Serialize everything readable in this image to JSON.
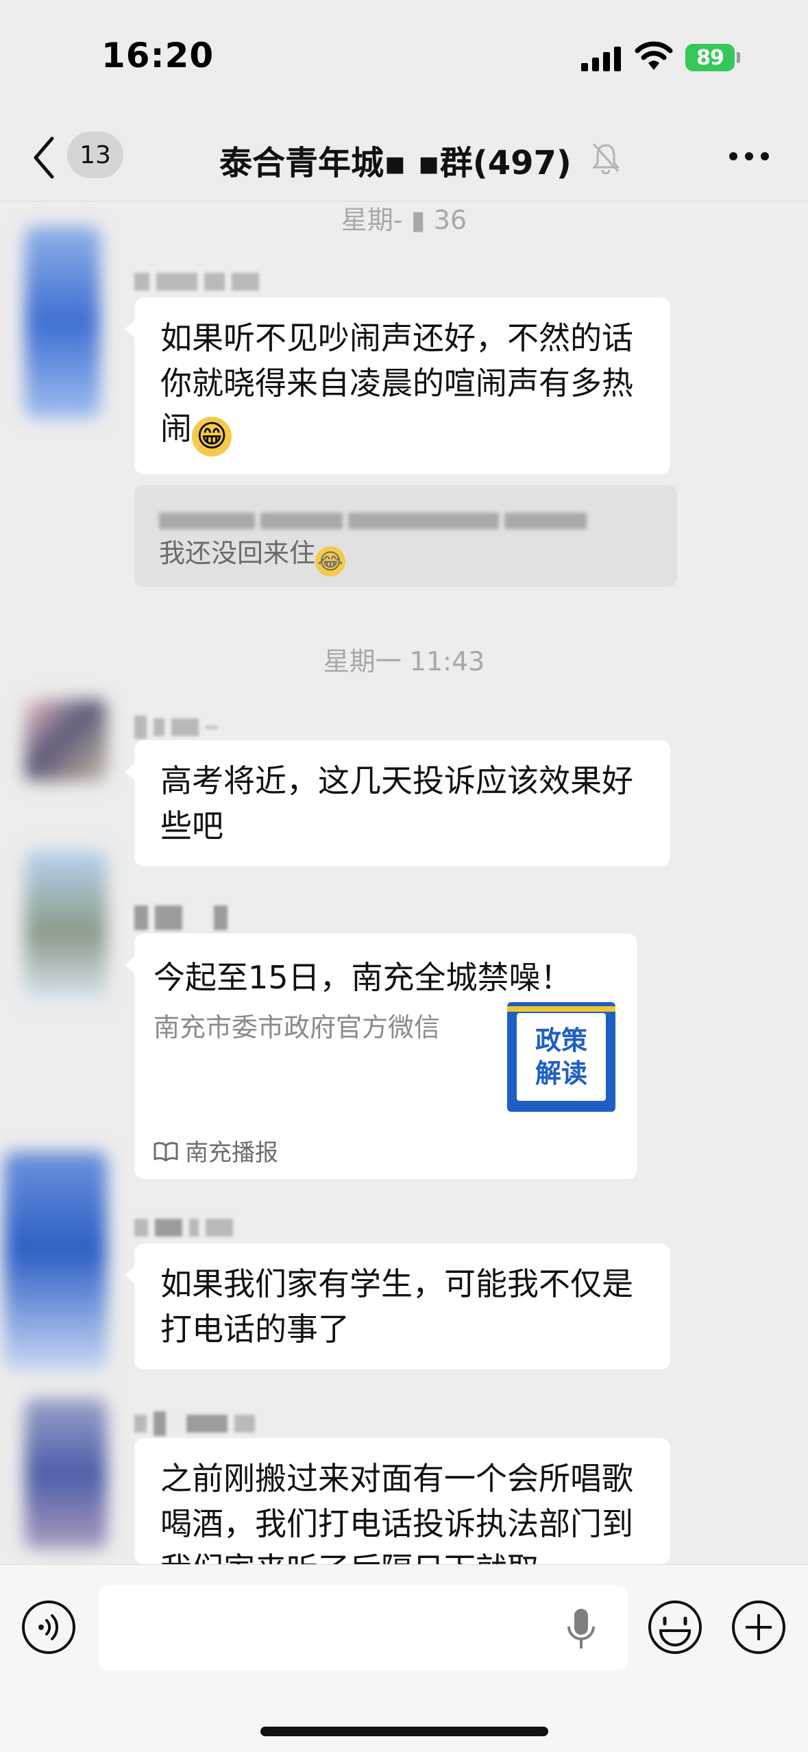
{
  "status_bar": {
    "time": "16:20",
    "battery": "89"
  },
  "nav": {
    "unread_count": "13",
    "title": "泰合青年城▪ ▪群(497)"
  },
  "chat": {
    "time_separators": [
      "星期- ▮ 36",
      "星期一 11:43"
    ],
    "messages": [
      {
        "text": "如果听不见吵闹声还好，不然的话你就晓得来自凌晨的喧闹声有多热闹",
        "emoji": "😁"
      },
      {
        "quote_visible_text": "我还没回来住",
        "emoji": "😂"
      },
      {
        "text": "高考将近，这几天投诉应该效果好些吧"
      },
      {
        "card_title": "今起至15日，南充全城禁噪！",
        "card_desc": "南充市委市政府官方微信",
        "card_thumb_line1": "政策",
        "card_thumb_line2": "解读",
        "card_source": "南充播报"
      },
      {
        "text": "如果我们家有学生，可能我不仅是打电话的事了"
      },
      {
        "text": "之前刚搬过来对面有一个会所唱歌喝酒，我们打电话投诉执法部门到我们家来听了后隔日下就取"
      }
    ]
  },
  "colors": {
    "background": "#ededed",
    "bubble": "#ffffff",
    "battery": "#35c759",
    "thumb_blue": "#1e5fc6"
  },
  "icons": [
    "back-chevron-icon",
    "mute-bell-icon",
    "more-dots-icon",
    "voice-icon",
    "mic-icon",
    "emoji-icon",
    "plus-icon",
    "book-icon"
  ]
}
